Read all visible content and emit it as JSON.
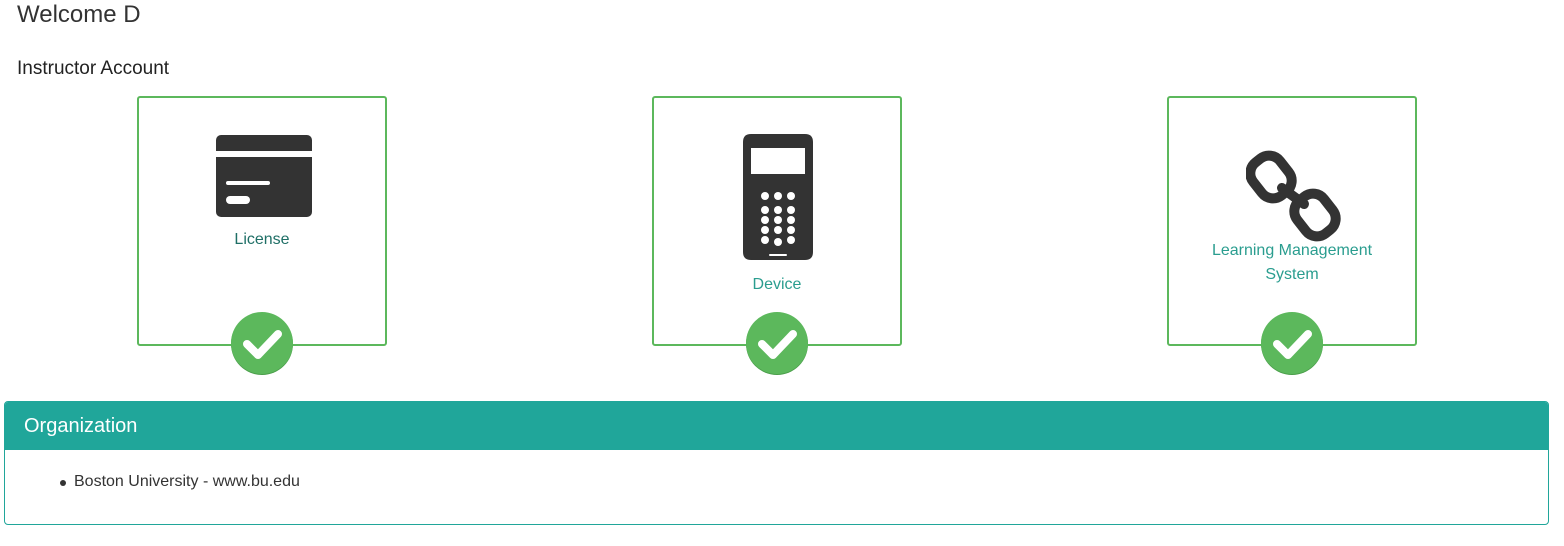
{
  "header": {
    "welcome": "Welcome D",
    "account_type": "Instructor Account"
  },
  "tiles": [
    {
      "label": "License",
      "icon": "license-card-icon",
      "status": "check-icon"
    },
    {
      "label": "Device",
      "icon": "clicker-device-icon",
      "status": "check-icon"
    },
    {
      "label_line1": "Learning Management",
      "label_line2": "System",
      "icon": "chain-link-icon",
      "status": "check-icon"
    }
  ],
  "organization": {
    "title": "Organization",
    "items": [
      "Boston University - www.bu.edu"
    ]
  },
  "colors": {
    "accent": "#20a69a",
    "success": "#5cb85c",
    "icon": "#333333"
  }
}
